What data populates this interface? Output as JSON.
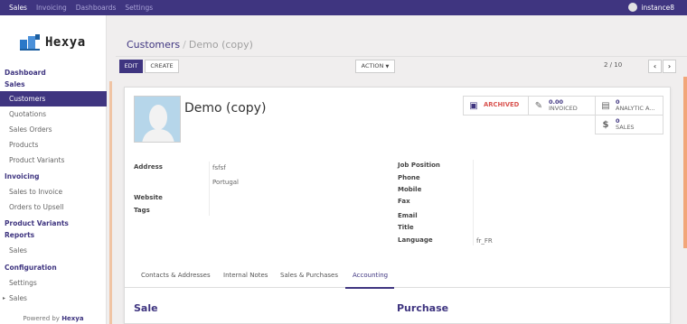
{
  "topnav": {
    "items": [
      "Sales",
      "Invoicing",
      "Dashboards",
      "Settings"
    ],
    "active": "Sales",
    "user": "instance8"
  },
  "brand": {
    "name": "Hexya",
    "powered_prefix": "Powered by",
    "powered_name": "Hexya"
  },
  "sidebar": {
    "dashboard": "Dashboard",
    "sales": "Sales",
    "customers": "Customers",
    "quotations": "Quotations",
    "sales_orders": "Sales Orders",
    "products": "Products",
    "product_variants": "Product Variants",
    "invoicing": "Invoicing",
    "sales_to_invoice": "Sales to Invoice",
    "orders_to_upsell": "Orders to Upsell",
    "product_variants_header": "Product Variants",
    "reports": "Reports",
    "reports_sales": "Sales",
    "configuration": "Configuration",
    "settings": "Settings",
    "config_sales": "Sales"
  },
  "breadcrumb": {
    "parent": "Customers",
    "current": "Demo (copy)"
  },
  "toolbar": {
    "edit": "EDIT",
    "create": "CREATE",
    "action": "ACTION",
    "pager": "2 / 10"
  },
  "record": {
    "name": "Demo (copy)"
  },
  "stat_buttons": {
    "archived": "ARCHIVED",
    "invoiced_value": "0.00",
    "invoiced_label": "INVOICED",
    "analytic_value": "0",
    "analytic_label": "ANALYTIC A...",
    "sales_value": "0",
    "sales_label": "SALES"
  },
  "fields": {
    "address_label": "Address",
    "address_line1": "fsfsf",
    "address_country": "Portugal",
    "website_label": "Website",
    "tags_label": "Tags",
    "job_position_label": "Job Position",
    "phone_label": "Phone",
    "mobile_label": "Mobile",
    "fax_label": "Fax",
    "email_label": "Email",
    "title_label": "Title",
    "language_label": "Language",
    "language_value": "fr_FR"
  },
  "tabs": [
    "Contacts & Addresses",
    "Internal Notes",
    "Sales & Purchases",
    "Accounting"
  ],
  "active_tab": "Accounting",
  "sections": {
    "sale": "Sale",
    "purchase": "Purchase"
  },
  "colors": {
    "brand": "#3f3580",
    "archived": "#d9534f",
    "accent_strip": "#f2a679"
  }
}
